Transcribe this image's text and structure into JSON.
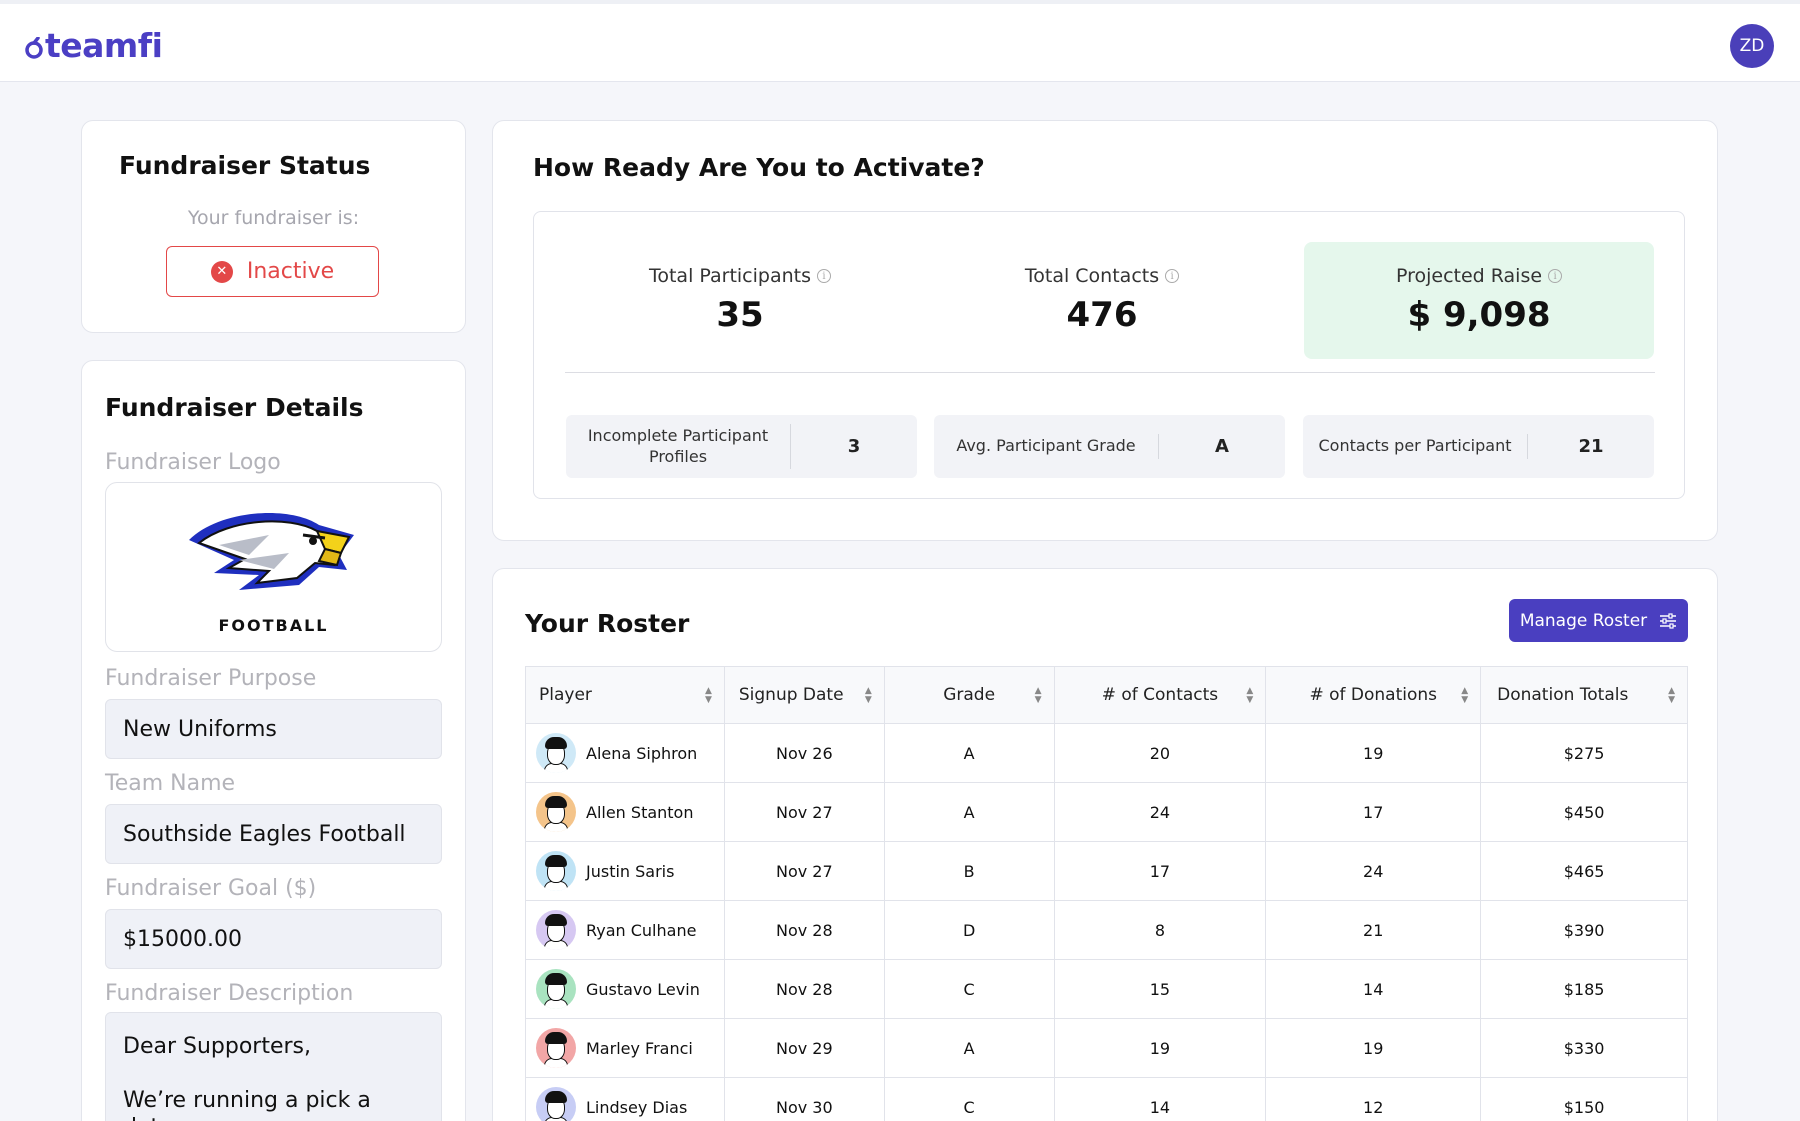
{
  "brand": {
    "name": "teamfi",
    "accent": "#4b3fc4"
  },
  "user": {
    "initials": "ZD"
  },
  "status": {
    "title": "Fundraiser Status",
    "subtitle": "Your fundraiser is:",
    "state": "Inactive",
    "icon": "x-circle-icon",
    "color": "#e34848"
  },
  "details": {
    "title": "Fundraiser Details",
    "logo_label": "Fundraiser Logo",
    "logo_text": "FOOTBALL",
    "purpose_label": "Fundraiser Purpose",
    "purpose_value": "New Uniforms",
    "team_label": "Team Name",
    "team_value": "Southside Eagles Football",
    "goal_label": "Fundraiser Goal ($)",
    "goal_value": "$15000.00",
    "description_label": "Fundraiser Description",
    "description_line1": "Dear Supporters,",
    "description_line2": "We’re running a pick a date"
  },
  "ready": {
    "title": "How Ready Are You to Activate?",
    "stats": [
      {
        "label": "Total Participants",
        "value": "35"
      },
      {
        "label": "Total Contacts",
        "value": "476"
      },
      {
        "label": "Projected Raise",
        "value": "$ 9,098"
      }
    ],
    "mini": [
      {
        "label": "Incomplete Participant Profiles",
        "value": "3"
      },
      {
        "label": "Avg. Participant Grade",
        "value": "A"
      },
      {
        "label": "Contacts per Participant",
        "value": "21"
      }
    ]
  },
  "roster": {
    "title": "Your Roster",
    "manage_label": "Manage Roster",
    "columns": [
      "Player",
      "Signup Date",
      "Grade",
      "# of Contacts",
      "# of Donations",
      "Donation Totals"
    ],
    "rows": [
      {
        "player": "Alena Siphron",
        "date": "Nov 26",
        "grade": "A",
        "contacts": "20",
        "donations": "19",
        "total": "$275",
        "avatar_bg": "#cfe9f7"
      },
      {
        "player": "Allen Stanton",
        "date": "Nov 27",
        "grade": "A",
        "contacts": "24",
        "donations": "17",
        "total": "$450",
        "avatar_bg": "#f4c48a"
      },
      {
        "player": "Justin Saris",
        "date": "Nov 27",
        "grade": "B",
        "contacts": "17",
        "donations": "24",
        "total": "$465",
        "avatar_bg": "#bfe3f5"
      },
      {
        "player": "Ryan Culhane",
        "date": "Nov 28",
        "grade": "D",
        "contacts": "8",
        "donations": "21",
        "total": "$390",
        "avatar_bg": "#d6c8f2"
      },
      {
        "player": "Gustavo Levin",
        "date": "Nov 28",
        "grade": "C",
        "contacts": "15",
        "donations": "14",
        "total": "$185",
        "avatar_bg": "#a9e3c0"
      },
      {
        "player": "Marley Franci",
        "date": "Nov 29",
        "grade": "A",
        "contacts": "19",
        "donations": "19",
        "total": "$330",
        "avatar_bg": "#f2a6a6"
      },
      {
        "player": "Lindsey Dias",
        "date": "Nov 30",
        "grade": "C",
        "contacts": "14",
        "donations": "12",
        "total": "$150",
        "avatar_bg": "#c7cdf5"
      }
    ]
  }
}
